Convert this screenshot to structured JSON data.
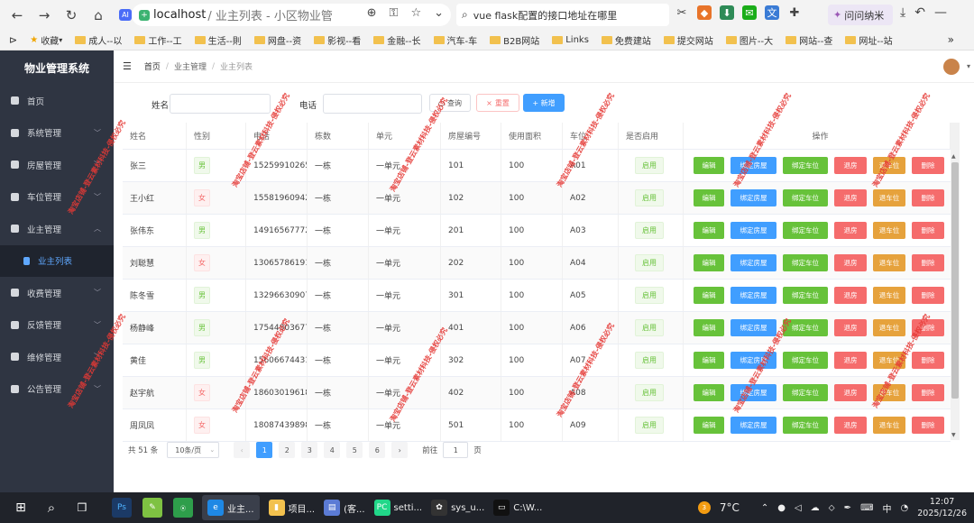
{
  "browser": {
    "address_host": "localhost",
    "address_path": "/ 业主列表 - 小区物业管",
    "search_text": "vue flask配置的接口地址在哪里",
    "ask_label": "问问纳米",
    "bookmarks": [
      "收藏",
      "成人--以",
      "工作--工",
      "生活--則",
      "网盘--资",
      "影视--看",
      "金融--长",
      "汽车-车",
      "B2B网站",
      "Links",
      "免费建站",
      "提交网站",
      "图片--大",
      "网站--查",
      "网址--站"
    ],
    "more": "»"
  },
  "sidebar": {
    "title": "物业管理系统",
    "items": [
      {
        "label": "首页",
        "has_arrow": false
      },
      {
        "label": "系统管理",
        "has_arrow": true
      },
      {
        "label": "房屋管理",
        "has_arrow": true
      },
      {
        "label": "车位管理",
        "has_arrow": true
      },
      {
        "label": "业主管理",
        "has_arrow": true,
        "expanded": true
      },
      {
        "label": "收费管理",
        "has_arrow": true
      },
      {
        "label": "反馈管理",
        "has_arrow": true
      },
      {
        "label": "维修管理",
        "has_arrow": true
      },
      {
        "label": "公告管理",
        "has_arrow": true
      }
    ],
    "sub_item": "业主列表"
  },
  "breadcrumb": [
    "首页",
    "业主管理",
    "业主列表"
  ],
  "filters": {
    "name_label": "姓名",
    "phone_label": "电话",
    "query_btn": "查询",
    "reset_btn": "重置",
    "add_btn": "+ 新增"
  },
  "table": {
    "headers": [
      "姓名",
      "性别",
      "电话",
      "栋数",
      "单元",
      "房屋编号",
      "使用面积",
      "车位",
      "是否启用",
      "操作"
    ],
    "rows": [
      {
        "name": "张三",
        "gender": "男",
        "phone": "15259910265",
        "building": "一栋",
        "unit": "一单元",
        "room": "101",
        "area": "100",
        "parking": "A01",
        "enabled": "启用"
      },
      {
        "name": "王小红",
        "gender": "女",
        "phone": "15581960942",
        "building": "一栋",
        "unit": "一单元",
        "room": "102",
        "area": "100",
        "parking": "A02",
        "enabled": "启用"
      },
      {
        "name": "张伟东",
        "gender": "男",
        "phone": "14916567772",
        "building": "一栋",
        "unit": "一单元",
        "room": "201",
        "area": "100",
        "parking": "A03",
        "enabled": "启用"
      },
      {
        "name": "刘聪慧",
        "gender": "女",
        "phone": "13065786191",
        "building": "一栋",
        "unit": "一单元",
        "room": "202",
        "area": "100",
        "parking": "A04",
        "enabled": "启用"
      },
      {
        "name": "陈冬雪",
        "gender": "男",
        "phone": "13296630907",
        "building": "一栋",
        "unit": "一单元",
        "room": "301",
        "area": "100",
        "parking": "A05",
        "enabled": "启用"
      },
      {
        "name": "杨静峰",
        "gender": "男",
        "phone": "17544803677",
        "building": "一栋",
        "unit": "一单元",
        "room": "401",
        "area": "100",
        "parking": "A06",
        "enabled": "启用"
      },
      {
        "name": "黄佳",
        "gender": "男",
        "phone": "15606674431",
        "building": "一栋",
        "unit": "一单元",
        "room": "302",
        "area": "100",
        "parking": "A07",
        "enabled": "启用"
      },
      {
        "name": "赵宇航",
        "gender": "女",
        "phone": "18603019618",
        "building": "一栋",
        "unit": "一单元",
        "room": "402",
        "area": "100",
        "parking": "A08",
        "enabled": "启用"
      },
      {
        "name": "周凤凤",
        "gender": "女",
        "phone": "18087439898",
        "building": "一栋",
        "unit": "一单元",
        "room": "501",
        "area": "100",
        "parking": "A09",
        "enabled": "启用"
      }
    ],
    "op_buttons": [
      {
        "label": "编辑",
        "color": "#67c23a"
      },
      {
        "label": "绑定房屋",
        "color": "#409eff"
      },
      {
        "label": "绑定车位",
        "color": "#67c23a"
      },
      {
        "label": "退房",
        "color": "#f56c6c"
      },
      {
        "label": "退车位",
        "color": "#e6a23c"
      },
      {
        "label": "删除",
        "color": "#f56c6c"
      }
    ]
  },
  "pagination": {
    "total": "共 51 条",
    "page_size": "10条/页",
    "pages": [
      "1",
      "2",
      "3",
      "4",
      "5",
      "6"
    ],
    "goto_label": "前往",
    "goto_value": "1",
    "page_suffix": "页"
  },
  "watermark": "淘宝店铺-登云素材科技-侵权必究",
  "taskbar": {
    "apps": [
      "业主...",
      "项目...",
      "(客...",
      "setti...",
      "sys_u...",
      "C:\\W..."
    ],
    "weather_badge": "3",
    "temperature": "7°C",
    "ime": "中",
    "time": "12:07",
    "date": "2025/12/26"
  }
}
